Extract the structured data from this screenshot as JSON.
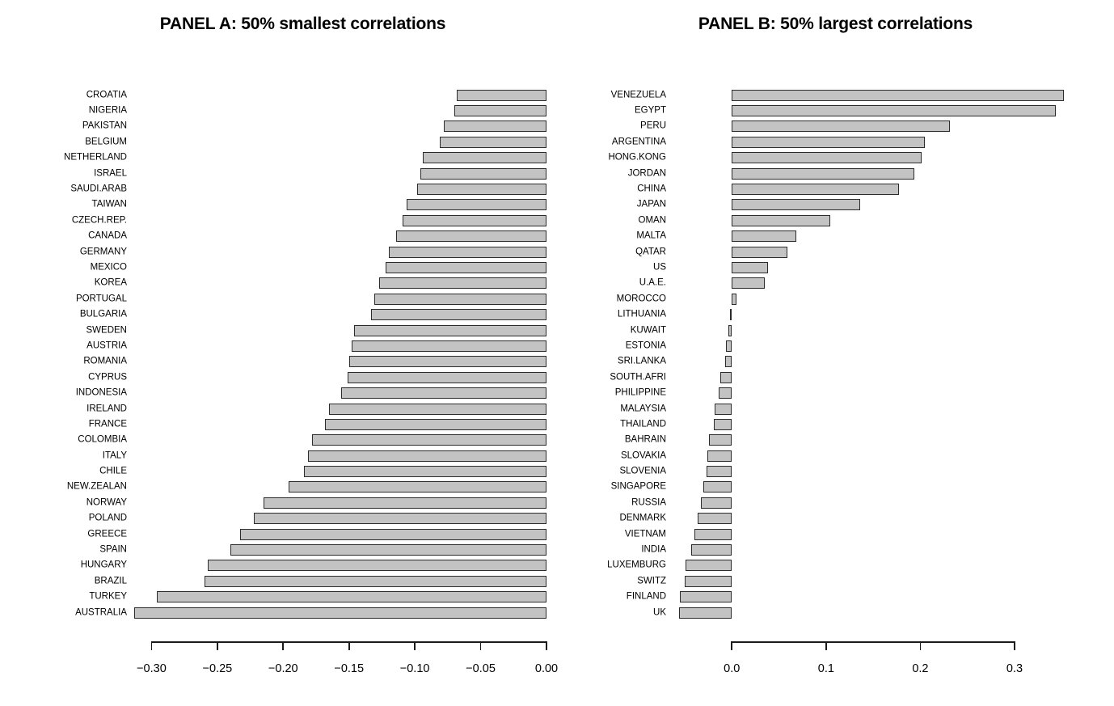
{
  "figure": {
    "background": "#ffffff",
    "bar_fill": "#c3c3c3",
    "bar_border": "#2b2b2b",
    "text_color": "#000000"
  },
  "panel_a": {
    "title": "PANEL A: 50% smallest correlations"
  },
  "panel_b": {
    "title": "PANEL B: 50% largest correlations"
  },
  "chart_data": [
    {
      "type": "bar",
      "orientation": "horizontal",
      "title": "PANEL A: 50% smallest correlations",
      "xlabel": "",
      "ylabel": "",
      "xlim": [
        -0.315,
        0.0
      ],
      "xticks": [
        -0.3,
        -0.25,
        -0.2,
        -0.15,
        -0.1,
        -0.05,
        0.0
      ],
      "xticklabels": [
        "−0.30",
        "−0.25",
        "−0.20",
        "−0.15",
        "−0.10",
        "−0.05",
        "0.00"
      ],
      "grid": false,
      "legend": false,
      "categories": [
        "CROATIA",
        "NIGERIA",
        "PAKISTAN",
        "BELGIUM",
        "NETHERLAND",
        "ISRAEL",
        "SAUDI.ARAB",
        "TAIWAN",
        "CZECH.REP.",
        "CANADA",
        "GERMANY",
        "MEXICO",
        "KOREA",
        "PORTUGAL",
        "BULGARIA",
        "SWEDEN",
        "AUSTRIA",
        "ROMANIA",
        "CYPRUS",
        "INDONESIA",
        "IRELAND",
        "FRANCE",
        "COLOMBIA",
        "ITALY",
        "CHILE",
        "NEW.ZEALAN",
        "NORWAY",
        "POLAND",
        "GREECE",
        "SPAIN",
        "HUNGARY",
        "BRAZIL",
        "TURKEY",
        "AUSTRALIA"
      ],
      "values": [
        -0.068,
        -0.07,
        -0.078,
        -0.081,
        -0.094,
        -0.096,
        -0.098,
        -0.106,
        -0.109,
        -0.114,
        -0.12,
        -0.122,
        -0.127,
        -0.131,
        -0.133,
        -0.146,
        -0.148,
        -0.15,
        -0.151,
        -0.156,
        -0.165,
        -0.168,
        -0.178,
        -0.181,
        -0.184,
        -0.196,
        -0.215,
        -0.222,
        -0.233,
        -0.24,
        -0.257,
        -0.26,
        -0.296,
        -0.313
      ]
    },
    {
      "type": "bar",
      "orientation": "horizontal",
      "title": "PANEL B: 50% largest correlations",
      "xlabel": "",
      "ylabel": "",
      "xlim": [
        -0.056,
        0.306
      ],
      "xticks": [
        0.0,
        0.1,
        0.2,
        0.3
      ],
      "xticklabels": [
        "0.0",
        "0.1",
        "0.2",
        "0.3"
      ],
      "grid": false,
      "legend": false,
      "categories": [
        "VENEZUELA",
        "EGYPT",
        "PERU",
        "ARGENTINA",
        "HONG.KONG",
        "JORDAN",
        "CHINA",
        "JAPAN",
        "OMAN",
        "MALTA",
        "QATAR",
        "US",
        "U.A.E.",
        "MOROCCO",
        "LITHUANIA",
        "KUWAIT",
        "ESTONIA",
        "SRI.LANKA",
        "SOUTH.AFRI",
        "PHILIPPINE",
        "MALAYSIA",
        "THAILAND",
        "BAHRAIN",
        "SLOVAKIA",
        "SLOVENIA",
        "SINGAPORE",
        "RUSSIA",
        "DENMARK",
        "VIETNAM",
        "INDIA",
        "LUXEMBURG",
        "SWITZ",
        "FINLAND",
        "UK"
      ],
      "values": [
        0.352,
        0.344,
        0.231,
        0.205,
        0.201,
        0.194,
        0.177,
        0.136,
        0.104,
        0.068,
        0.059,
        0.038,
        0.035,
        0.005,
        -0.002,
        -0.004,
        -0.006,
        -0.007,
        -0.012,
        -0.014,
        -0.018,
        -0.019,
        -0.024,
        -0.026,
        -0.027,
        -0.03,
        -0.033,
        -0.036,
        -0.04,
        -0.043,
        -0.049,
        -0.05,
        -0.055,
        -0.056
      ]
    }
  ]
}
